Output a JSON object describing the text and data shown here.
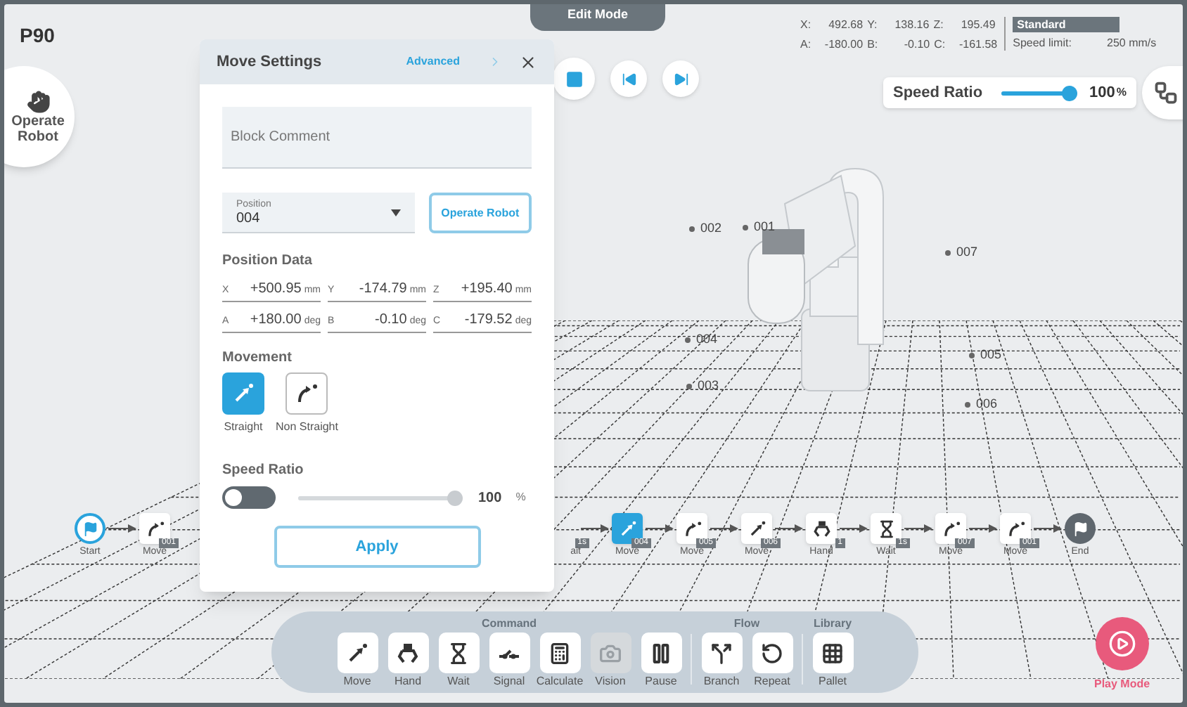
{
  "program": {
    "title": "P90"
  },
  "mode_tab": "Edit Mode",
  "side_button": {
    "label": "Operate Robot"
  },
  "readout": {
    "rows": [
      [
        {
          "axis": "X:",
          "value": "492.68"
        },
        {
          "axis": "Y:",
          "value": "138.16"
        },
        {
          "axis": "Z:",
          "value": "195.49"
        }
      ],
      [
        {
          "axis": "A:",
          "value": "-180.00"
        },
        {
          "axis": "B:",
          "value": "-0.10"
        },
        {
          "axis": "C:",
          "value": "-161.58"
        }
      ]
    ]
  },
  "speed_profile": {
    "name": "Standard",
    "limit_label": "Speed limit:",
    "limit_value": "250 mm/s"
  },
  "speed_ratio": {
    "label": "Speed Ratio",
    "level": 0.96,
    "reading": "100",
    "unit": "%"
  },
  "dialog": {
    "title": "Move Settings",
    "advanced": "Advanced",
    "comment_placeholder": "Block Comment",
    "position": {
      "label": "Position",
      "value": "004"
    },
    "operate_button": "Operate Robot",
    "position_data": {
      "title": "Position Data",
      "rows": [
        [
          {
            "axis": "X",
            "value": "+500.95",
            "unit": "mm"
          },
          {
            "axis": "Y",
            "value": "-174.79",
            "unit": "mm"
          },
          {
            "axis": "Z",
            "value": "+195.40",
            "unit": "mm"
          }
        ],
        [
          {
            "axis": "A",
            "value": "+180.00",
            "unit": "deg"
          },
          {
            "axis": "B",
            "value": "-0.10",
            "unit": "deg"
          },
          {
            "axis": "C",
            "value": "-179.52",
            "unit": "deg"
          }
        ]
      ]
    },
    "movement": {
      "title": "Movement",
      "options": [
        {
          "kind": "straight",
          "label": "Straight",
          "selected": true
        },
        {
          "kind": "curve",
          "label": "Non Straight",
          "selected": false
        }
      ]
    },
    "speed": {
      "title": "Speed Ratio",
      "on": false,
      "level": 1,
      "reading": "100",
      "unit": "%"
    },
    "apply": "Apply"
  },
  "scene": {
    "points": [
      {
        "label": "002"
      },
      {
        "label": "001"
      },
      {
        "label": "007"
      },
      {
        "label": "004"
      },
      {
        "label": "005"
      },
      {
        "label": "003"
      },
      {
        "label": "006"
      }
    ]
  },
  "flow": {
    "nodes": [
      {
        "kind": "start",
        "label": "Start",
        "selected": false
      },
      {
        "kind": "curve",
        "label": "Move",
        "badge": "001",
        "selected": false
      },
      {
        "kind": "gap"
      },
      {
        "kind": "partial",
        "label": "ait",
        "badge": "1s"
      },
      {
        "kind": "straight",
        "label": "Move",
        "badge": "004",
        "selected": true
      },
      {
        "kind": "curve",
        "label": "Move",
        "badge": "005",
        "selected": false
      },
      {
        "kind": "straight",
        "label": "Move",
        "badge": "006",
        "selected": false
      },
      {
        "kind": "hand",
        "label": "Hand",
        "badge": "1",
        "selected": false
      },
      {
        "kind": "wait",
        "label": "Wait",
        "badge": "1s",
        "selected": false
      },
      {
        "kind": "curve",
        "label": "Move",
        "badge": "007",
        "selected": false
      },
      {
        "kind": "curve",
        "label": "Move",
        "badge": "001",
        "selected": false
      },
      {
        "kind": "end",
        "label": "End",
        "selected": false
      }
    ]
  },
  "command_bar": {
    "groups": [
      {
        "title": "Command",
        "items": [
          {
            "kind": "straight",
            "label": "Move",
            "disabled": false
          },
          {
            "kind": "hand",
            "label": "Hand",
            "disabled": false
          },
          {
            "kind": "wait",
            "label": "Wait",
            "disabled": false
          },
          {
            "kind": "signal",
            "label": "Signal",
            "disabled": false
          },
          {
            "kind": "calculate",
            "label": "Calculate",
            "disabled": false
          },
          {
            "kind": "vision",
            "label": "Vision",
            "disabled": true
          },
          {
            "kind": "pause",
            "label": "Pause",
            "disabled": false
          }
        ]
      },
      {
        "title": "Flow",
        "items": [
          {
            "kind": "branch",
            "label": "Branch",
            "disabled": false
          },
          {
            "kind": "repeat",
            "label": "Repeat",
            "disabled": false
          }
        ]
      },
      {
        "title": "Library",
        "items": [
          {
            "kind": "pallet",
            "label": "Pallet",
            "disabled": false
          }
        ]
      }
    ]
  },
  "play_mode": {
    "label": "Play Mode"
  }
}
